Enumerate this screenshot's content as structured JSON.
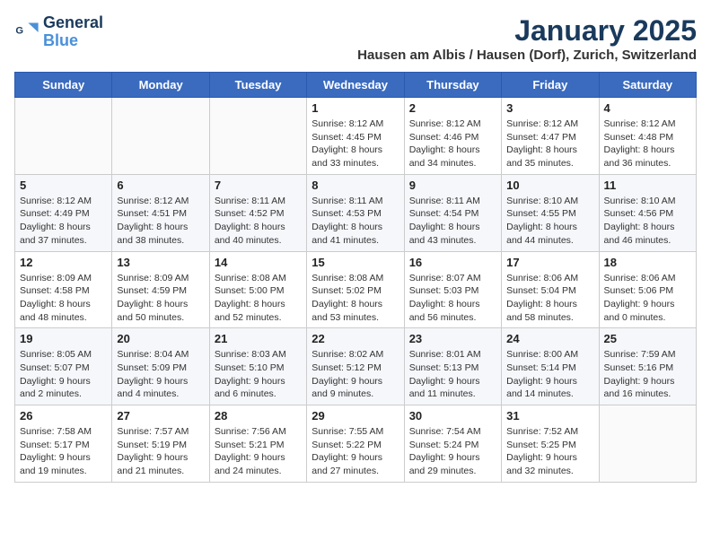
{
  "logo": {
    "line1": "General",
    "line2": "Blue"
  },
  "header": {
    "month": "January 2025",
    "location": "Hausen am Albis / Hausen (Dorf), Zurich, Switzerland"
  },
  "weekdays": [
    "Sunday",
    "Monday",
    "Tuesday",
    "Wednesday",
    "Thursday",
    "Friday",
    "Saturday"
  ],
  "weeks": [
    [
      {
        "day": "",
        "info": ""
      },
      {
        "day": "",
        "info": ""
      },
      {
        "day": "",
        "info": ""
      },
      {
        "day": "1",
        "info": "Sunrise: 8:12 AM\nSunset: 4:45 PM\nDaylight: 8 hours and 33 minutes."
      },
      {
        "day": "2",
        "info": "Sunrise: 8:12 AM\nSunset: 4:46 PM\nDaylight: 8 hours and 34 minutes."
      },
      {
        "day": "3",
        "info": "Sunrise: 8:12 AM\nSunset: 4:47 PM\nDaylight: 8 hours and 35 minutes."
      },
      {
        "day": "4",
        "info": "Sunrise: 8:12 AM\nSunset: 4:48 PM\nDaylight: 8 hours and 36 minutes."
      }
    ],
    [
      {
        "day": "5",
        "info": "Sunrise: 8:12 AM\nSunset: 4:49 PM\nDaylight: 8 hours and 37 minutes."
      },
      {
        "day": "6",
        "info": "Sunrise: 8:12 AM\nSunset: 4:51 PM\nDaylight: 8 hours and 38 minutes."
      },
      {
        "day": "7",
        "info": "Sunrise: 8:11 AM\nSunset: 4:52 PM\nDaylight: 8 hours and 40 minutes."
      },
      {
        "day": "8",
        "info": "Sunrise: 8:11 AM\nSunset: 4:53 PM\nDaylight: 8 hours and 41 minutes."
      },
      {
        "day": "9",
        "info": "Sunrise: 8:11 AM\nSunset: 4:54 PM\nDaylight: 8 hours and 43 minutes."
      },
      {
        "day": "10",
        "info": "Sunrise: 8:10 AM\nSunset: 4:55 PM\nDaylight: 8 hours and 44 minutes."
      },
      {
        "day": "11",
        "info": "Sunrise: 8:10 AM\nSunset: 4:56 PM\nDaylight: 8 hours and 46 minutes."
      }
    ],
    [
      {
        "day": "12",
        "info": "Sunrise: 8:09 AM\nSunset: 4:58 PM\nDaylight: 8 hours and 48 minutes."
      },
      {
        "day": "13",
        "info": "Sunrise: 8:09 AM\nSunset: 4:59 PM\nDaylight: 8 hours and 50 minutes."
      },
      {
        "day": "14",
        "info": "Sunrise: 8:08 AM\nSunset: 5:00 PM\nDaylight: 8 hours and 52 minutes."
      },
      {
        "day": "15",
        "info": "Sunrise: 8:08 AM\nSunset: 5:02 PM\nDaylight: 8 hours and 53 minutes."
      },
      {
        "day": "16",
        "info": "Sunrise: 8:07 AM\nSunset: 5:03 PM\nDaylight: 8 hours and 56 minutes."
      },
      {
        "day": "17",
        "info": "Sunrise: 8:06 AM\nSunset: 5:04 PM\nDaylight: 8 hours and 58 minutes."
      },
      {
        "day": "18",
        "info": "Sunrise: 8:06 AM\nSunset: 5:06 PM\nDaylight: 9 hours and 0 minutes."
      }
    ],
    [
      {
        "day": "19",
        "info": "Sunrise: 8:05 AM\nSunset: 5:07 PM\nDaylight: 9 hours and 2 minutes."
      },
      {
        "day": "20",
        "info": "Sunrise: 8:04 AM\nSunset: 5:09 PM\nDaylight: 9 hours and 4 minutes."
      },
      {
        "day": "21",
        "info": "Sunrise: 8:03 AM\nSunset: 5:10 PM\nDaylight: 9 hours and 6 minutes."
      },
      {
        "day": "22",
        "info": "Sunrise: 8:02 AM\nSunset: 5:12 PM\nDaylight: 9 hours and 9 minutes."
      },
      {
        "day": "23",
        "info": "Sunrise: 8:01 AM\nSunset: 5:13 PM\nDaylight: 9 hours and 11 minutes."
      },
      {
        "day": "24",
        "info": "Sunrise: 8:00 AM\nSunset: 5:14 PM\nDaylight: 9 hours and 14 minutes."
      },
      {
        "day": "25",
        "info": "Sunrise: 7:59 AM\nSunset: 5:16 PM\nDaylight: 9 hours and 16 minutes."
      }
    ],
    [
      {
        "day": "26",
        "info": "Sunrise: 7:58 AM\nSunset: 5:17 PM\nDaylight: 9 hours and 19 minutes."
      },
      {
        "day": "27",
        "info": "Sunrise: 7:57 AM\nSunset: 5:19 PM\nDaylight: 9 hours and 21 minutes."
      },
      {
        "day": "28",
        "info": "Sunrise: 7:56 AM\nSunset: 5:21 PM\nDaylight: 9 hours and 24 minutes."
      },
      {
        "day": "29",
        "info": "Sunrise: 7:55 AM\nSunset: 5:22 PM\nDaylight: 9 hours and 27 minutes."
      },
      {
        "day": "30",
        "info": "Sunrise: 7:54 AM\nSunset: 5:24 PM\nDaylight: 9 hours and 29 minutes."
      },
      {
        "day": "31",
        "info": "Sunrise: 7:52 AM\nSunset: 5:25 PM\nDaylight: 9 hours and 32 minutes."
      },
      {
        "day": "",
        "info": ""
      }
    ]
  ]
}
